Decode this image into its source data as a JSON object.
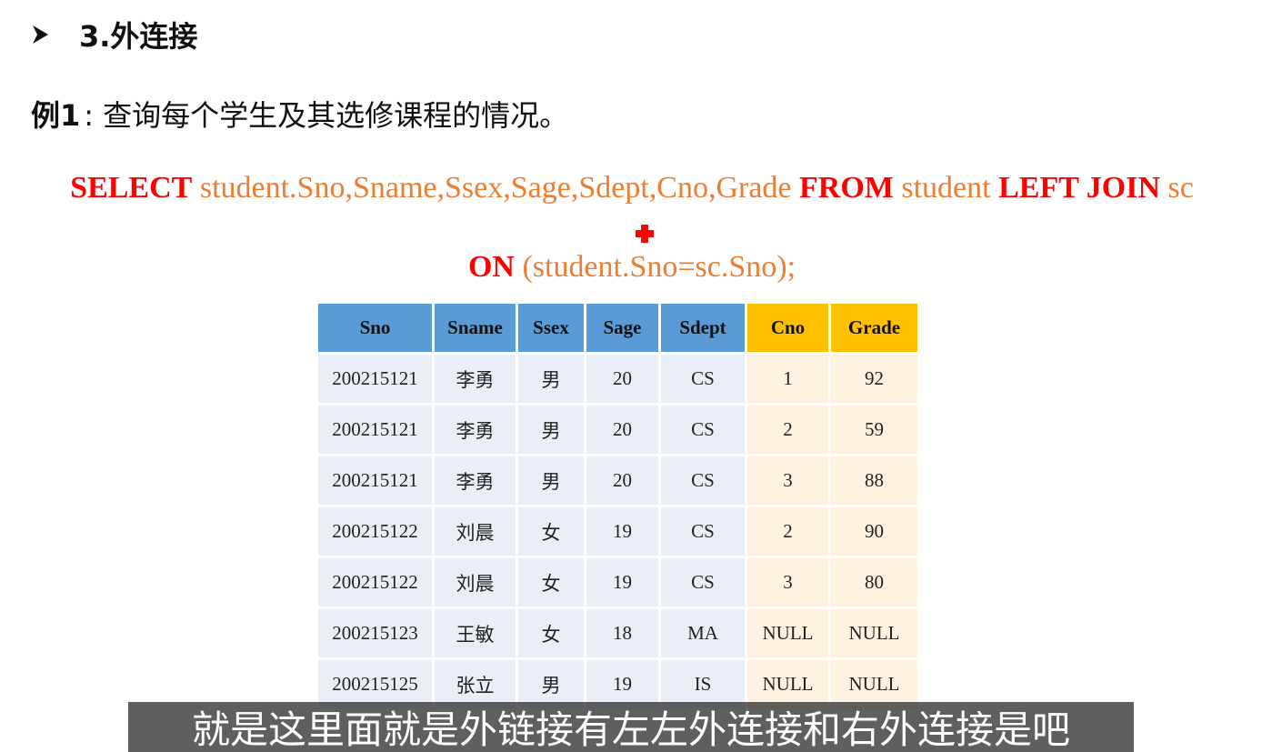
{
  "heading": {
    "bullet_icon": "arrow-bullet-icon",
    "text": "3.外连接"
  },
  "example": {
    "label": "例1",
    "colon": ":",
    "text": "查询每个学生及其选修课程的情况。"
  },
  "sql": {
    "line1": {
      "kw_select": "SELECT",
      "columns": " student.Sno,Sname,Ssex,Sage,Sdept,Cno,Grade ",
      "kw_from": "FROM",
      "from_table": " student ",
      "kw_left_join": "LEFT JOIN",
      "join_table": " sc"
    },
    "plus_icon": "red-plus-icon",
    "line2": {
      "kw_on": "ON",
      "condition": " (student.Sno=sc.Sno);"
    }
  },
  "table": {
    "headers": [
      "Sno",
      "Sname",
      "Ssex",
      "Sage",
      "Sdept",
      "Cno",
      "Grade"
    ],
    "rows": [
      [
        "200215121",
        "李勇",
        "男",
        "20",
        "CS",
        "1",
        "92"
      ],
      [
        "200215121",
        "李勇",
        "男",
        "20",
        "CS",
        "2",
        "59"
      ],
      [
        "200215121",
        "李勇",
        "男",
        "20",
        "CS",
        "3",
        "88"
      ],
      [
        "200215122",
        "刘晨",
        "女",
        "19",
        "CS",
        "2",
        "90"
      ],
      [
        "200215122",
        "刘晨",
        "女",
        "19",
        "CS",
        "3",
        "80"
      ],
      [
        "200215123",
        "王敏",
        "女",
        "18",
        "MA",
        "NULL",
        "NULL"
      ],
      [
        "200215125",
        "张立",
        "男",
        "19",
        "IS",
        "NULL",
        "NULL"
      ]
    ],
    "colors": {
      "left_header": "#5b9bd5",
      "right_header": "#ffc000",
      "left_cell": "#e9eef7",
      "right_cell": "#fff2e0"
    }
  },
  "subtitle": {
    "text": "就是这里面就是外链接有左左外连接和右外连接是吧"
  },
  "colors": {
    "keyword": "#ff0000",
    "sql_text": "#ed7d31"
  }
}
